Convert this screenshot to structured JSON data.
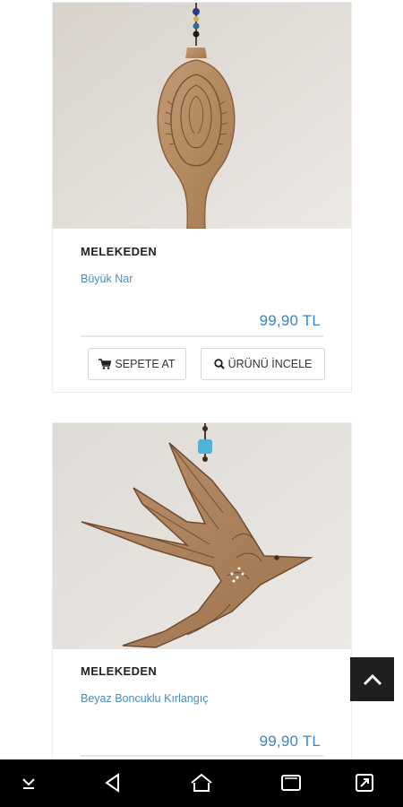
{
  "products": [
    {
      "brand": "MELEKEDEN",
      "name": "Büyük Nar",
      "price": "99,90 TL",
      "add_to_cart_label": "SEPETE AT",
      "view_label": "ÜRÜNÜ İNCELE"
    },
    {
      "brand": "MELEKEDEN",
      "name": "Beyaz Boncuklu Kırlangıç",
      "price": "99,90 TL"
    }
  ],
  "colors": {
    "accent": "#3a86c6",
    "link": "#4a8cc0",
    "scroll_button": "#1f1f1f",
    "nav_bar": "#000000"
  },
  "icons": {
    "cart": "cart-icon",
    "search": "search-icon",
    "scroll_top": "chevron-up-icon",
    "nav": [
      "collapse-down-icon",
      "back-icon",
      "home-icon",
      "recents-icon",
      "screenshot-icon"
    ]
  }
}
